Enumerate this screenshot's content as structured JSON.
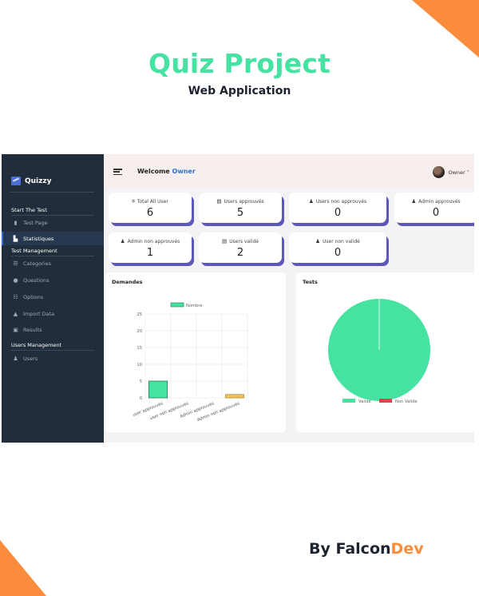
{
  "poster": {
    "title": "Quiz Project",
    "subtitle": "Web Application",
    "credit_prefix": "By Falcon",
    "credit_accent": "Dev",
    "accent_color": "#fb8c3b",
    "title_color": "#45e2a1"
  },
  "app": {
    "brand": "Quizzy",
    "sidebar": {
      "section_start": "Start The Test",
      "section_test_mgmt": "Test Management",
      "section_users_mgmt": "Users Management",
      "items": [
        {
          "label": "Test Page",
          "icon": "bar-chart-icon"
        },
        {
          "label": "Statistiques",
          "icon": "stats-icon"
        },
        {
          "label": "Categories",
          "icon": "list-icon"
        },
        {
          "label": "Questions",
          "icon": "question-icon"
        },
        {
          "label": "Options",
          "icon": "options-icon"
        },
        {
          "label": "Import Data",
          "icon": "upload-icon"
        },
        {
          "label": "Results",
          "icon": "results-icon"
        },
        {
          "label": "Users",
          "icon": "users-icon"
        }
      ]
    },
    "header": {
      "welcome": "Welcome",
      "owner": "Owner",
      "user_menu": "Owner ˅"
    },
    "cards": [
      {
        "label": "Total All User",
        "value": "6"
      },
      {
        "label": "Users approuvés",
        "value": "5"
      },
      {
        "label": "Users non approuvés",
        "value": "0"
      },
      {
        "label": "Admin approuvés",
        "value": "0"
      },
      {
        "label": "Admin non approuvés",
        "value": "1"
      },
      {
        "label": "Users validé",
        "value": "2"
      },
      {
        "label": "User non validé",
        "value": "0"
      }
    ],
    "panels": {
      "demandes": "Demandes",
      "tests": "Tests"
    }
  },
  "chart_data": [
    {
      "type": "bar",
      "title": "Demandes",
      "categories": [
        "user approuvés",
        "user non approuvés",
        "Admin approuvés",
        "Admin non approuvés"
      ],
      "series": [
        {
          "name": "Nombre",
          "values": [
            5,
            0,
            0,
            1
          ]
        }
      ],
      "bar_colors": [
        "#45e2a1",
        "#45e2a1",
        "#45e2a1",
        "#f0c45a"
      ],
      "yticks": [
        0,
        5,
        10,
        15,
        20,
        25
      ],
      "ylim": [
        0,
        25
      ],
      "grid": true,
      "legend": "top"
    },
    {
      "type": "pie",
      "title": "Tests",
      "categories": [
        "Valide",
        "Non Valide"
      ],
      "values": [
        100,
        0
      ],
      "colors": [
        "#45e2a1",
        "#e0474c"
      ],
      "legend": "bottom"
    }
  ]
}
